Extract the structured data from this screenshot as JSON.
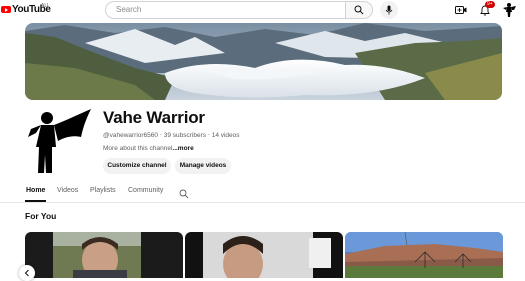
{
  "app": {
    "logo_text": "YouTube",
    "region": "AU"
  },
  "search": {
    "placeholder": "Search"
  },
  "header": {
    "notification_count": "9+"
  },
  "channel": {
    "name": "Vahe Warrior",
    "handle": "@vahewarrior6560",
    "subscribers": "39 subscribers",
    "videos": "14 videos",
    "about_text": "More about this channel",
    "about_more": "...more",
    "separator": "‧"
  },
  "actions": {
    "customize": "Customize channel",
    "manage": "Manage videos"
  },
  "tabs": [
    {
      "label": "Home",
      "active": true
    },
    {
      "label": "Videos",
      "active": false
    },
    {
      "label": "Playlists",
      "active": false
    },
    {
      "label": "Community",
      "active": false
    }
  ],
  "section": {
    "title": "For You"
  },
  "colors": {
    "brand": "#ff0000",
    "badge": "#cc0000",
    "text": "#0f0f0f",
    "secondary": "#606060"
  }
}
